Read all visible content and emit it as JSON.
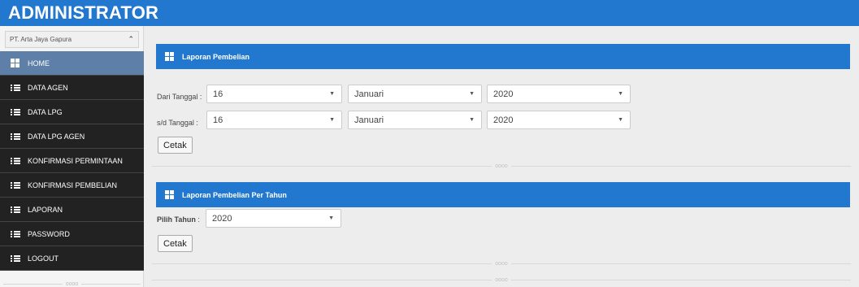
{
  "app": {
    "title": "ADMINISTRATOR"
  },
  "sidebar": {
    "company": "PT. Arta Jaya Gapura",
    "divider": "oooo",
    "items": [
      {
        "label": "HOME",
        "icon": "grid-icon",
        "active": true
      },
      {
        "label": "DATA AGEN",
        "icon": "list-icon",
        "active": false
      },
      {
        "label": "DATA LPG",
        "icon": "list-icon",
        "active": false
      },
      {
        "label": "DATA LPG AGEN",
        "icon": "list-icon",
        "active": false
      },
      {
        "label": "KONFIRMASI PERMINTAAN",
        "icon": "list-icon",
        "active": false
      },
      {
        "label": "KONFIRMASI PEMBELIAN",
        "icon": "list-icon",
        "active": false
      },
      {
        "label": "LAPORAN",
        "icon": "list-icon",
        "active": false
      },
      {
        "label": "PASSWORD",
        "icon": "list-icon",
        "active": false
      },
      {
        "label": "LOGOUT",
        "icon": "list-icon",
        "active": false
      }
    ]
  },
  "panel1": {
    "title": "Laporan Pembelian",
    "from_label": "Dari Tanggal :",
    "to_label": "s/d Tanggal  :",
    "from": {
      "day": "16",
      "month": "Januari",
      "year": "2020"
    },
    "to": {
      "day": "16",
      "month": "Januari",
      "year": "2020"
    },
    "print_label": "Cetak",
    "divider": "oooo"
  },
  "panel2": {
    "title": "Laporan Pembelian Per Tahun",
    "year_label": "Pilih Tahun",
    "year_sep": ":",
    "year": "2020",
    "print_label": "Cetak",
    "divider1": "oooo",
    "divider2": "oooo"
  },
  "colors": {
    "header": "#2277cf",
    "sidebar_active": "#5d7fa8",
    "sidebar_bg": "#222222"
  }
}
